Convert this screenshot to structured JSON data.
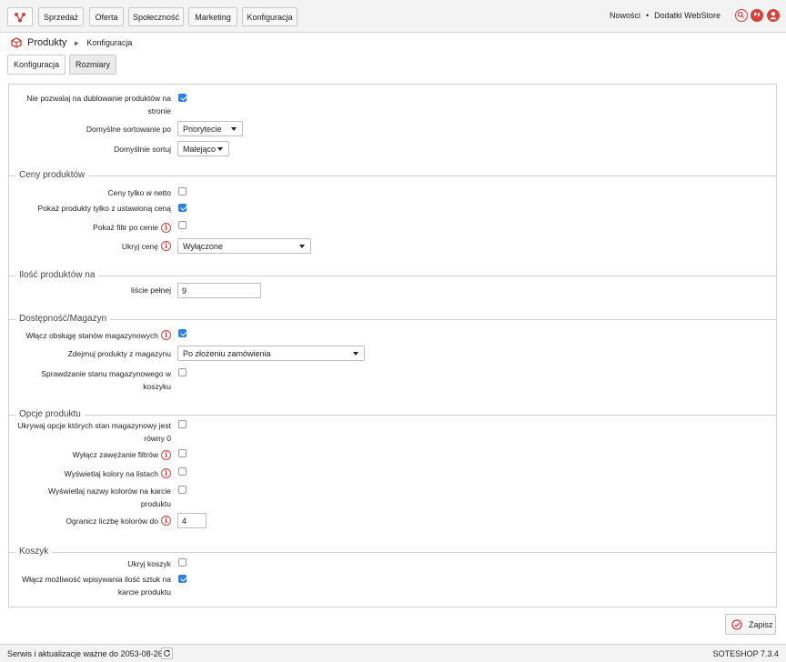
{
  "topnav": {
    "items": [
      "Sprzedaż",
      "Oferta",
      "Społeczność",
      "Marketing",
      "Konfiguracja"
    ],
    "links": [
      "Nowości",
      "Dodatki WebStore"
    ]
  },
  "breadcrumb": {
    "module": "Produkty",
    "current": "Konfiguracja"
  },
  "tabs": [
    "Konfiguracja",
    "Rozmiary"
  ],
  "general": {
    "no_duplicate_label": "Nie pozwalaj na dublowanie produktów na stronie",
    "no_duplicate_checked": true,
    "default_sort_label": "Domyślne sortowanie po",
    "default_sort_value": "Priorytecie",
    "default_order_label": "Domyślnie sortuj",
    "default_order_value": "Malejąco"
  },
  "prices": {
    "title": "Ceny produktów",
    "net_only_label": "Ceny tylko w netto",
    "net_only_checked": false,
    "with_price_label": "Pokaż produkty tylko z ustawioną ceną",
    "with_price_checked": true,
    "price_filter_label": "Pokaż filtr po cenie",
    "price_filter_checked": false,
    "hide_price_label": "Ukryj cenę",
    "hide_price_value": "Wyłączone"
  },
  "count": {
    "title": "Ilość produktów na",
    "full_list_label": "liście pełnej",
    "full_list_value": "9"
  },
  "stock": {
    "title": "Dostępność/Magazyn",
    "enable_label": "Włącz obsługę stanów magazynowych",
    "enable_checked": true,
    "remove_label": "Zdejmuj produkty z magazynu",
    "remove_value": "Po złożeniu zamówienia",
    "check_cart_label": "Sprawdzanie stanu magazynowego w koszyku",
    "check_cart_checked": false
  },
  "options": {
    "title": "Opcje produktu",
    "hide_zero_label": "Ukrywaj opcje których stan magazynowy jest równy 0",
    "hide_zero_checked": false,
    "disable_narrow_label": "Wyłącz zawężanie filtrów",
    "disable_narrow_checked": false,
    "colors_list_label": "Wyświetlaj kolory na listach",
    "colors_list_checked": false,
    "color_names_label": "Wyświetlaj nazwy kolorów na karcie produktu",
    "color_names_checked": false,
    "limit_colors_label": "Ogranicz liczbę kolorów do",
    "limit_colors_value": "4"
  },
  "cart": {
    "title": "Koszyk",
    "hide_cart_label": "Ukryj koszyk",
    "hide_cart_checked": false,
    "qty_input_label": "Włącz możliwość wpisywania ilość sztuk na karcie produktu",
    "qty_input_checked": true
  },
  "save_label": "Zapisz",
  "footer": {
    "service_text": "Serwis i aktualizacje ważne do 2053-08-26",
    "version": "SOTESHOP 7.3.4"
  },
  "colors": {
    "accent": "#d9403a",
    "checkbox": "#2a7fe0"
  }
}
